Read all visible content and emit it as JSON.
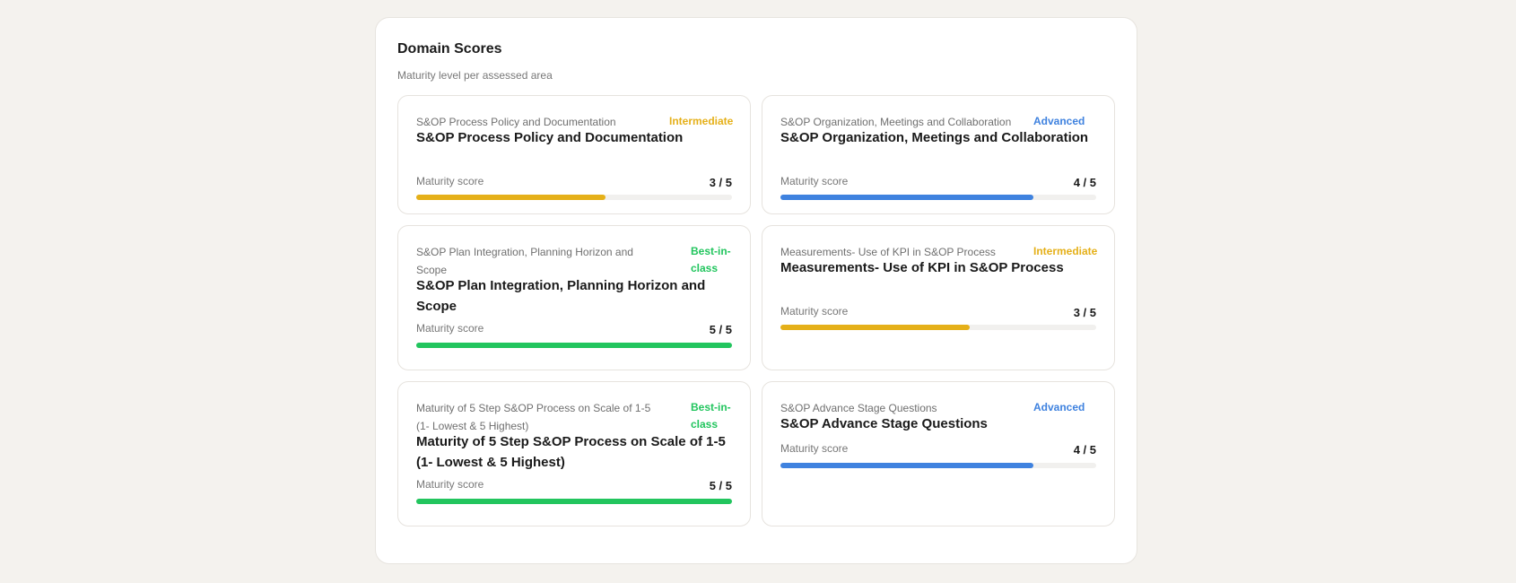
{
  "panel": {
    "title": "Domain Scores",
    "subtitle": "Maturity level per assessed area"
  },
  "colors": {
    "Intermediate": "#e5b019",
    "Advanced": "#3f82df",
    "Best-in-class": "#22c55e"
  },
  "cards": [
    {
      "area": "S&OP Process Policy and Documentation",
      "level": "Intermediate",
      "name": "S&OP Process Policy and Documentation",
      "score_label": "Maturity score",
      "score_text": "3 / 5",
      "score": 3,
      "max": 5
    },
    {
      "area": "S&OP Organization, Meetings and Collaboration",
      "level": "Advanced",
      "name": "S&OP Organization, Meetings and Collaboration",
      "score_label": "Maturity score",
      "score_text": "4 / 5",
      "score": 4,
      "max": 5
    },
    {
      "area": "S&OP Plan Integration, Planning Horizon and Scope",
      "level": "Best-in-class",
      "name": "S&OP Plan Integration, Planning Horizon and Scope",
      "score_label": "Maturity score",
      "score_text": "5 / 5",
      "score": 5,
      "max": 5
    },
    {
      "area": "Measurements- Use of KPI in S&OP Process",
      "level": "Intermediate",
      "name": "Measurements- Use of KPI in S&OP Process",
      "score_label": "Maturity score",
      "score_text": "3 / 5",
      "score": 3,
      "max": 5
    },
    {
      "area": "Maturity of 5 Step S&OP Process on Scale of 1-5 (1- Lowest & 5 Highest)",
      "level": "Best-in-class",
      "name": "Maturity of 5 Step S&OP Process on Scale of 1-5 (1- Lowest & 5 Highest)",
      "score_label": "Maturity score",
      "score_text": "5 / 5",
      "score": 5,
      "max": 5
    },
    {
      "area": "S&OP Advance Stage Questions",
      "level": "Advanced",
      "name": "S&OP Advance Stage Questions",
      "score_label": "Maturity score",
      "score_text": "4 / 5",
      "score": 4,
      "max": 5
    }
  ]
}
